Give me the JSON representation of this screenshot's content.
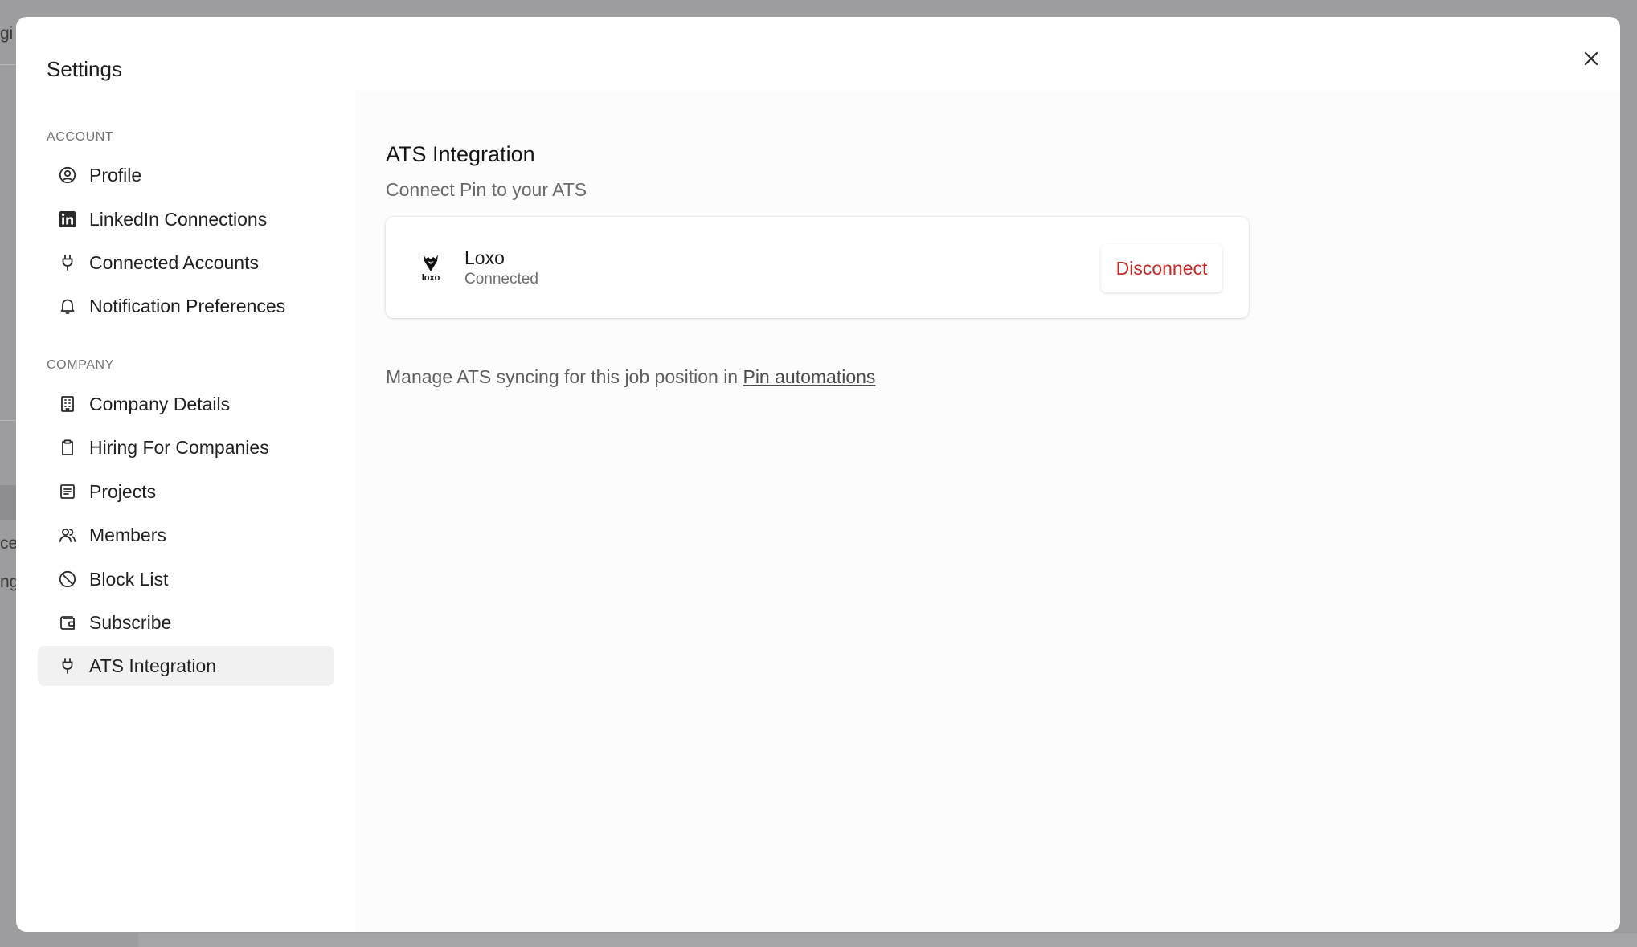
{
  "background": {
    "fragments": [
      "gi",
      "ce",
      "ng"
    ]
  },
  "modal": {
    "title": "Settings"
  },
  "sidebar": {
    "account_label": "ACCOUNT",
    "company_label": "COMPANY",
    "items": [
      {
        "label": "Profile",
        "icon": "user-circle-icon"
      },
      {
        "label": "LinkedIn Connections",
        "icon": "linkedin-icon"
      },
      {
        "label": "Connected Accounts",
        "icon": "plug-icon"
      },
      {
        "label": "Notification Preferences",
        "icon": "bell-icon"
      },
      {
        "label": "Company Details",
        "icon": "building-icon"
      },
      {
        "label": "Hiring For Companies",
        "icon": "clipboard-icon"
      },
      {
        "label": "Projects",
        "icon": "list-icon"
      },
      {
        "label": "Members",
        "icon": "users-icon"
      },
      {
        "label": "Block List",
        "icon": "ban-icon"
      },
      {
        "label": "Subscribe",
        "icon": "wallet-icon"
      },
      {
        "label": "ATS Integration",
        "icon": "plug-icon",
        "active": true
      }
    ]
  },
  "content": {
    "title": "ATS Integration",
    "subtitle": "Connect Pin to your ATS",
    "integration": {
      "name": "Loxo",
      "status": "Connected",
      "logo_text": "loxo",
      "disconnect_label": "Disconnect"
    },
    "manage_text": "Manage ATS syncing for this job position in ",
    "manage_link": "Pin automations"
  },
  "colors": {
    "danger": "#c62828",
    "overlay": "#9d9d9f",
    "active_item_bg": "#f1f1f1"
  }
}
